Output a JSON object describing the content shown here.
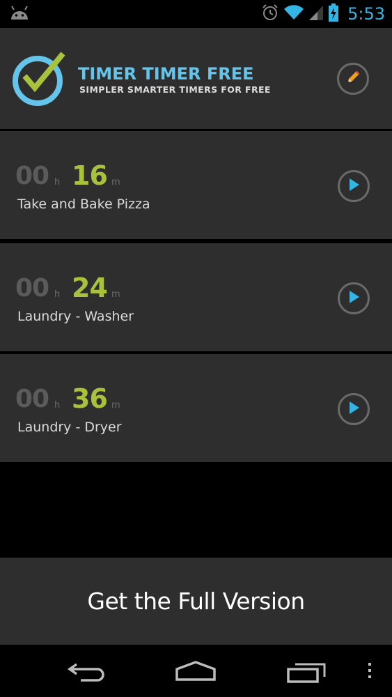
{
  "status_bar": {
    "time": "5:53",
    "icons": [
      "android-icon",
      "alarm-icon",
      "wifi-icon",
      "signal-icon",
      "battery-icon"
    ]
  },
  "app": {
    "title": "TIMER TIMER FREE",
    "subtitle": "SIMPLER SMARTER TIMERS FOR FREE",
    "accent_color": "#65c4ea",
    "minutes_color": "#a8c23c"
  },
  "timers": [
    {
      "hours": "00",
      "hours_unit": "h",
      "minutes": "16",
      "minutes_unit": "m",
      "label": "Take and Bake Pizza"
    },
    {
      "hours": "00",
      "hours_unit": "h",
      "minutes": "24",
      "minutes_unit": "m",
      "label": "Laundry - Washer"
    },
    {
      "hours": "00",
      "hours_unit": "h",
      "minutes": "36",
      "minutes_unit": "m",
      "label": "Laundry - Dryer"
    }
  ],
  "banner": {
    "text": "Get the Full Version"
  },
  "nav": {
    "icons": [
      "back-icon",
      "home-icon",
      "recents-icon",
      "overflow-menu-icon"
    ]
  }
}
